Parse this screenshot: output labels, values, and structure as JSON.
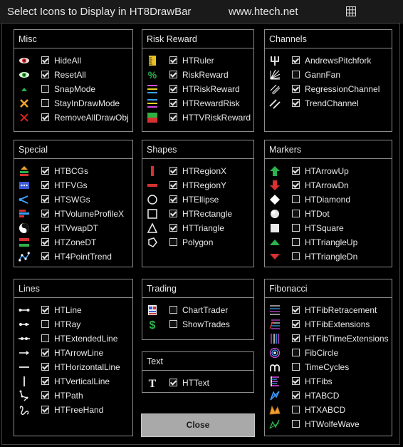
{
  "window": {
    "title": "Select Icons to Display in HT8DrawBar",
    "url": "www.htech.net",
    "close_label": "Close"
  },
  "groups": [
    {
      "key": "misc",
      "title": "Misc",
      "items": [
        {
          "label": "HideAll",
          "checked": true,
          "icon": "eye-red-icon"
        },
        {
          "label": "ResetAll",
          "checked": true,
          "icon": "eye-green-icon"
        },
        {
          "label": "SnapMode",
          "checked": false,
          "icon": "snap-triangle-icon"
        },
        {
          "label": "StayInDrawMode",
          "checked": false,
          "icon": "cross-orange-icon"
        },
        {
          "label": "RemoveAllDrawObj",
          "checked": true,
          "icon": "cross-red-icon"
        }
      ]
    },
    {
      "key": "riskreward",
      "title": "Risk Reward",
      "items": [
        {
          "label": "HTRuler",
          "checked": true,
          "icon": "ruler-icon"
        },
        {
          "label": "RiskReward",
          "checked": true,
          "icon": "percent-icon"
        },
        {
          "label": "HTRiskReward",
          "checked": true,
          "icon": "risk-reward-lines-icon"
        },
        {
          "label": "HTRewardRisk",
          "checked": true,
          "icon": "reward-risk-lines-icon"
        },
        {
          "label": "HTTVRiskReward",
          "checked": true,
          "icon": "tv-risk-reward-icon"
        }
      ]
    },
    {
      "key": "channels",
      "title": "Channels",
      "items": [
        {
          "label": "AndrewsPitchfork",
          "checked": true,
          "icon": "pitchfork-icon"
        },
        {
          "label": "GannFan",
          "checked": false,
          "icon": "gann-fan-icon"
        },
        {
          "label": "RegressionChannel",
          "checked": true,
          "icon": "regression-channel-icon"
        },
        {
          "label": "TrendChannel",
          "checked": true,
          "icon": "trend-channel-icon"
        }
      ]
    },
    {
      "key": "special",
      "title": "Special",
      "items": [
        {
          "label": "HTBCGs",
          "checked": true,
          "icon": "bcg-icon"
        },
        {
          "label": "HTFVGs",
          "checked": true,
          "icon": "fvg-icon"
        },
        {
          "label": "HTSWGs",
          "checked": true,
          "icon": "swg-icon"
        },
        {
          "label": "HTVolumeProfileX",
          "checked": true,
          "icon": "volume-profile-icon"
        },
        {
          "label": "HTVwapDT",
          "checked": true,
          "icon": "vwap-icon"
        },
        {
          "label": "HTZoneDT",
          "checked": true,
          "icon": "zone-icon"
        },
        {
          "label": "HT4PointTrend",
          "checked": true,
          "icon": "four-point-trend-icon"
        }
      ]
    },
    {
      "key": "shapes",
      "title": "Shapes",
      "items": [
        {
          "label": "HTRegionX",
          "checked": true,
          "icon": "region-x-icon"
        },
        {
          "label": "HTRegionY",
          "checked": true,
          "icon": "region-y-icon"
        },
        {
          "label": "HTEllipse",
          "checked": true,
          "icon": "ellipse-icon"
        },
        {
          "label": "HTRectangle",
          "checked": true,
          "icon": "rectangle-icon"
        },
        {
          "label": "HTTriangle",
          "checked": true,
          "icon": "triangle-icon"
        },
        {
          "label": "Polygon",
          "checked": false,
          "icon": "polygon-icon"
        }
      ]
    },
    {
      "key": "markers",
      "title": "Markers",
      "items": [
        {
          "label": "HTArrowUp",
          "checked": true,
          "icon": "arrow-up-green-icon"
        },
        {
          "label": "HTArrowDn",
          "checked": true,
          "icon": "arrow-down-red-icon"
        },
        {
          "label": "HTDiamond",
          "checked": false,
          "icon": "diamond-icon"
        },
        {
          "label": "HTDot",
          "checked": false,
          "icon": "dot-icon"
        },
        {
          "label": "HTSquare",
          "checked": false,
          "icon": "square-icon"
        },
        {
          "label": "HTTriangleUp",
          "checked": false,
          "icon": "triangle-up-green-icon"
        },
        {
          "label": "HTTriangleDn",
          "checked": false,
          "icon": "triangle-down-red-icon"
        }
      ]
    },
    {
      "key": "lines",
      "title": "Lines",
      "items": [
        {
          "label": "HTLine",
          "checked": true,
          "icon": "line-segment-icon"
        },
        {
          "label": "HTRay",
          "checked": false,
          "icon": "ray-icon"
        },
        {
          "label": "HTExtendedLine",
          "checked": false,
          "icon": "extended-line-icon"
        },
        {
          "label": "HTArrowLine",
          "checked": true,
          "icon": "arrow-line-icon"
        },
        {
          "label": "HTHorizontalLine",
          "checked": true,
          "icon": "horizontal-line-icon"
        },
        {
          "label": "HTVerticalLine",
          "checked": true,
          "icon": "vertical-line-icon"
        },
        {
          "label": "HTPath",
          "checked": true,
          "icon": "path-icon"
        },
        {
          "label": "HTFreeHand",
          "checked": true,
          "icon": "freehand-icon"
        }
      ]
    },
    {
      "key": "trading",
      "title": "Trading",
      "items": [
        {
          "label": "ChartTrader",
          "checked": false,
          "icon": "chart-trader-icon"
        },
        {
          "label": "ShowTrades",
          "checked": false,
          "icon": "dollar-icon"
        }
      ]
    },
    {
      "key": "text",
      "title": "Text",
      "items": [
        {
          "label": "HTText",
          "checked": true,
          "icon": "text-t-icon"
        }
      ]
    },
    {
      "key": "fibonacci",
      "title": "Fibonacci",
      "items": [
        {
          "label": "HTFibRetracement",
          "checked": true,
          "icon": "fib-retracement-icon"
        },
        {
          "label": "HTFibExtensions",
          "checked": true,
          "icon": "fib-extensions-icon"
        },
        {
          "label": "HTFibTimeExtensions",
          "checked": true,
          "icon": "fib-time-extensions-icon"
        },
        {
          "label": "FibCircle",
          "checked": false,
          "icon": "fib-circle-icon"
        },
        {
          "label": "TimeCycles",
          "checked": false,
          "icon": "time-cycles-icon"
        },
        {
          "label": "HTFibs",
          "checked": true,
          "icon": "fibs-icon"
        },
        {
          "label": "HTABCD",
          "checked": true,
          "icon": "abcd-icon"
        },
        {
          "label": "HTXABCD",
          "checked": false,
          "icon": "xabcd-icon"
        },
        {
          "label": "HTWolfeWave",
          "checked": false,
          "icon": "wolfe-wave-icon"
        }
      ]
    }
  ]
}
